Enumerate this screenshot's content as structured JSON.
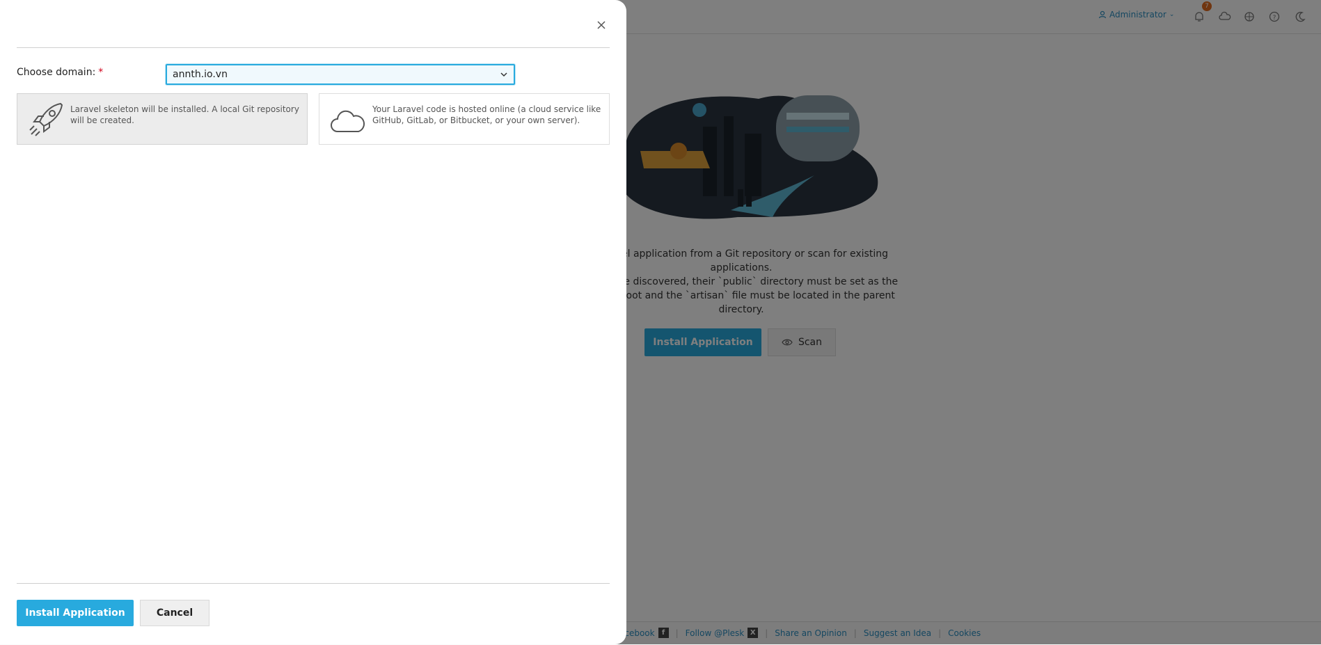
{
  "header": {
    "user_label": "Administrator",
    "notification_count": "7"
  },
  "background": {
    "empty_state_lines": [
      "Laravel application from a Git repository or scan for existing",
      "applications.",
      "ons to be discovered, their `public` directory must be set as the",
      "ument root and the `artisan` file must be located in the parent",
      "directory."
    ],
    "install_button": "Install Application",
    "scan_button": "Scan",
    "footer_links": [
      "acebook",
      "Follow @Plesk",
      "Share an Opinion",
      "Suggest an Idea",
      "Cookies"
    ]
  },
  "dialog": {
    "domain_label": "Choose domain:",
    "required_mark": "*",
    "domain_value": "annth.io.vn",
    "options": [
      {
        "icon": "rocket-icon",
        "text": "Laravel skeleton will be installed. A local Git repository will be created.",
        "selected": true
      },
      {
        "icon": "cloud-icon",
        "text": "Your Laravel code is hosted online (a cloud service like GitHub, GitLab, or Bitbucket, or your own server).",
        "selected": false
      }
    ],
    "install_button": "Install Application",
    "cancel_button": "Cancel"
  },
  "colors": {
    "accent": "#28aade",
    "link": "#2b8fc2",
    "badge": "#e06a1f",
    "overlay": "rgba(0,0,0,0.5)"
  }
}
